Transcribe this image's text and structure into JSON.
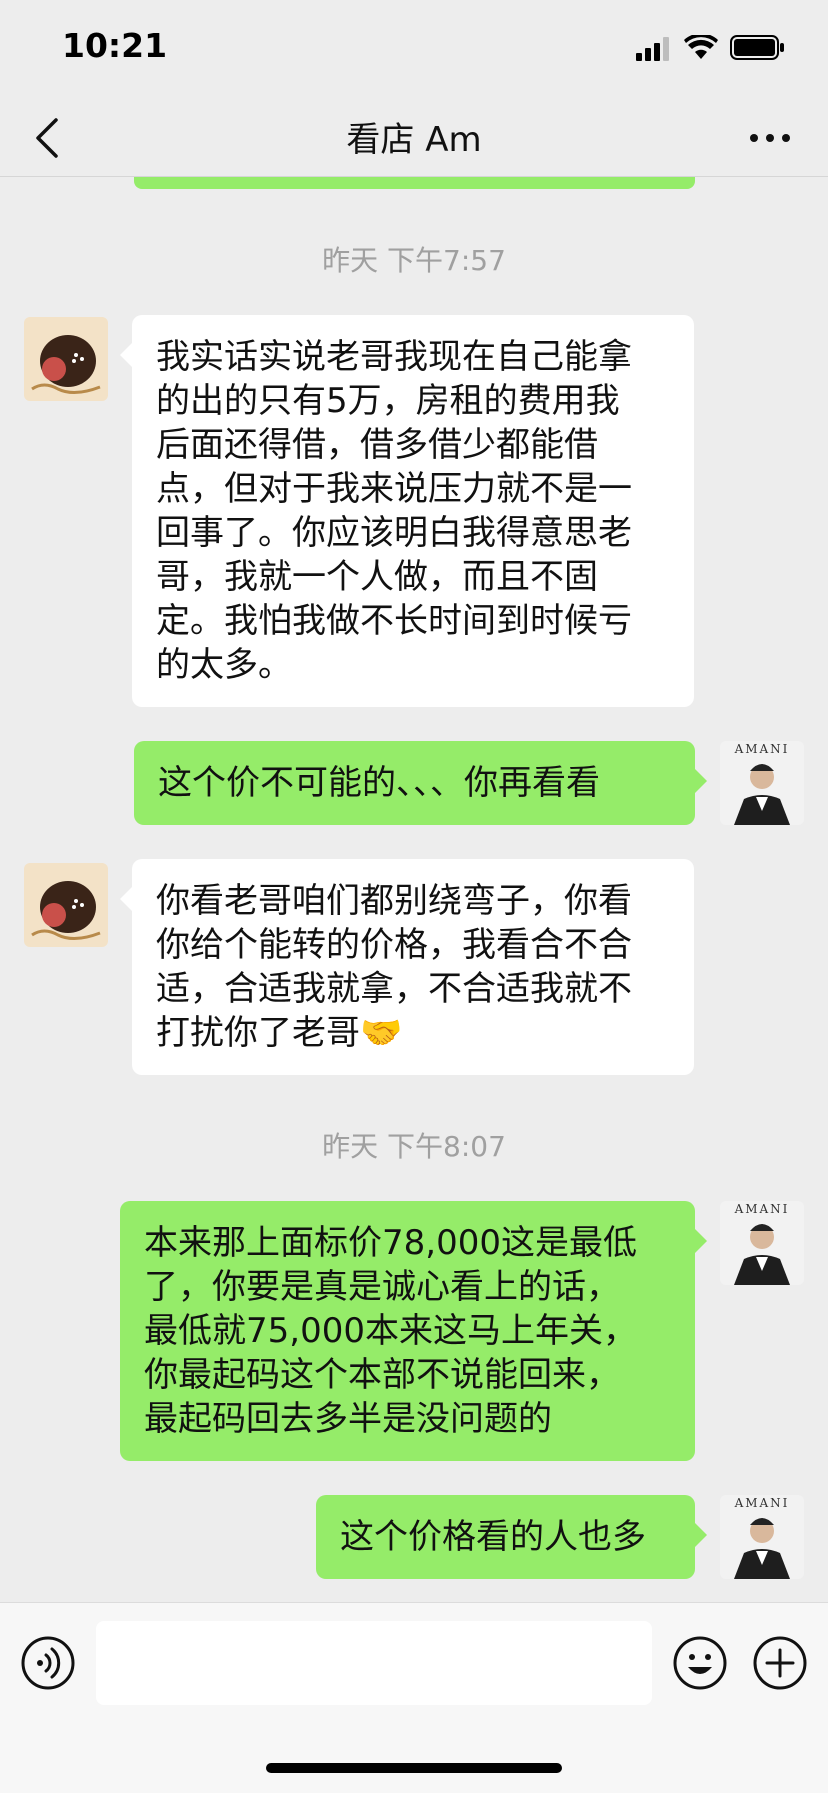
{
  "status_bar": {
    "time": "10:21"
  },
  "nav": {
    "title": "看店 Am",
    "back_icon": "chevron-left-icon",
    "more_icon": "more-dots-icon"
  },
  "chat": {
    "timestamps": [
      "昨天 下午7:57",
      "昨天 下午8:07"
    ],
    "messages": [
      {
        "side": "in",
        "lines": [
          "我实话实说老哥我现在自己能拿",
          "的出的只有5万，房租的费用我",
          "后面还得借，借多借少都能借",
          "点，但对于我来说压力就不是一",
          "回事了。你应该明白我得意思老",
          "哥，我就一个人做，而且不固",
          "定。我怕我做不长时间到时候亏",
          "的太多。"
        ]
      },
      {
        "side": "out",
        "lines": [
          "这个价不可能的、、、你再看看"
        ]
      },
      {
        "side": "in",
        "lines": [
          "你看老哥咱们都别绕弯子，你看",
          "你给个能转的价格，我看合不合",
          "适，合适我就拿，不合适我就不",
          "打扰你了老哥🤝"
        ]
      },
      {
        "side": "out",
        "lines": [
          "本来那上面标价78,000这是最低",
          "了，你要是真是诚心看上的话，",
          "最低就75,000本来这马上年关，",
          "你最起码这个本部不说能回来，",
          "最起码回去多半是没问题的"
        ]
      },
      {
        "side": "out",
        "lines": [
          "这个价格看的人也多"
        ]
      }
    ],
    "self_avatar_text": "AMANI"
  },
  "input_bar": {
    "voice_icon": "voice-icon",
    "emoji_icon": "emoji-icon",
    "plus_icon": "plus-icon"
  },
  "colors": {
    "background": "#ededed",
    "outgoing_bubble": "#95ec69",
    "incoming_bubble": "#ffffff",
    "timestamp": "#a0a0a0"
  }
}
